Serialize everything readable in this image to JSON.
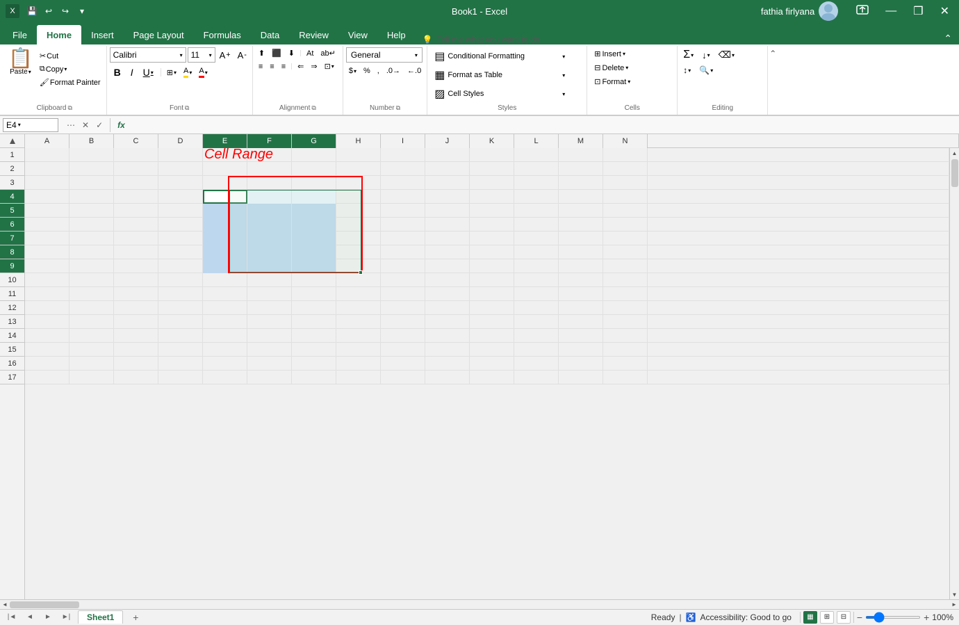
{
  "titleBar": {
    "appName": "Book1  -  Excel",
    "userName": "fathia firlyana",
    "saveIcon": "💾",
    "undoIcon": "↩",
    "redoIcon": "↪",
    "customizeIcon": "▾",
    "minimizeBtn": "—",
    "restoreBtn": "❒",
    "closeBtn": "✕"
  },
  "ribbonTabs": [
    {
      "label": "File",
      "active": false
    },
    {
      "label": "Home",
      "active": true
    },
    {
      "label": "Insert",
      "active": false
    },
    {
      "label": "Page Layout",
      "active": false
    },
    {
      "label": "Formulas",
      "active": false
    },
    {
      "label": "Data",
      "active": false
    },
    {
      "label": "Review",
      "active": false
    },
    {
      "label": "View",
      "active": false
    },
    {
      "label": "Help",
      "active": false
    }
  ],
  "tellMe": {
    "placeholder": "Tell me what you want to do",
    "icon": "💡"
  },
  "clipboard": {
    "label": "Clipboard",
    "pasteLabel": "Paste",
    "cutLabel": "Cut",
    "copyLabel": "Copy",
    "formatPainterLabel": "Format Painter"
  },
  "font": {
    "label": "Font",
    "fontName": "Calibri",
    "fontSize": "11",
    "boldLabel": "B",
    "italicLabel": "I",
    "underlineLabel": "U",
    "growLabel": "A↑",
    "shrinkLabel": "A↓"
  },
  "alignment": {
    "label": "Alignment",
    "atLabel": "At"
  },
  "number": {
    "label": "Number",
    "format": "General"
  },
  "styles": {
    "label": "Styles",
    "conditionalFormatting": "Conditional Formatting",
    "formatAsTable": "Format as Table",
    "cellStyles": "Cell Styles",
    "conditionalIcon": "▤",
    "tableIcon": "▦",
    "stylesIcon": "▨"
  },
  "cells": {
    "label": "Cells",
    "insertLabel": "Insert",
    "deleteLabel": "Delete",
    "formatLabel": "Format"
  },
  "editing": {
    "label": "Editing",
    "sumLabel": "Σ",
    "sortLabel": "↕",
    "findLabel": "🔍",
    "clearLabel": "⌫"
  },
  "formulaBar": {
    "cellRef": "E4",
    "cancelBtn": "✕",
    "confirmBtn": "✓",
    "formulaBtn": "fx",
    "formula": ""
  },
  "columns": [
    "A",
    "B",
    "C",
    "D",
    "E",
    "F",
    "G",
    "H",
    "I",
    "J",
    "K",
    "L",
    "M",
    "N"
  ],
  "rows": [
    1,
    2,
    3,
    4,
    5,
    6,
    7,
    8,
    9,
    10,
    11,
    12,
    13,
    14,
    15,
    16,
    17
  ],
  "cellRangeText": "Cell Range",
  "activeCell": "E4",
  "selectedRange": "E4:G9",
  "sheetTabs": [
    {
      "label": "Sheet1",
      "active": true
    }
  ],
  "statusBar": {
    "ready": "Ready",
    "accessibility": "Accessibility: Good to go",
    "zoom": "100%"
  },
  "colors": {
    "excelGreen": "#217346",
    "selectionBlue": "#bdd7ee",
    "activeCellBorder": "#217346",
    "redBorder": "#ff0000",
    "cellRangeTextColor": "#ff0000"
  }
}
